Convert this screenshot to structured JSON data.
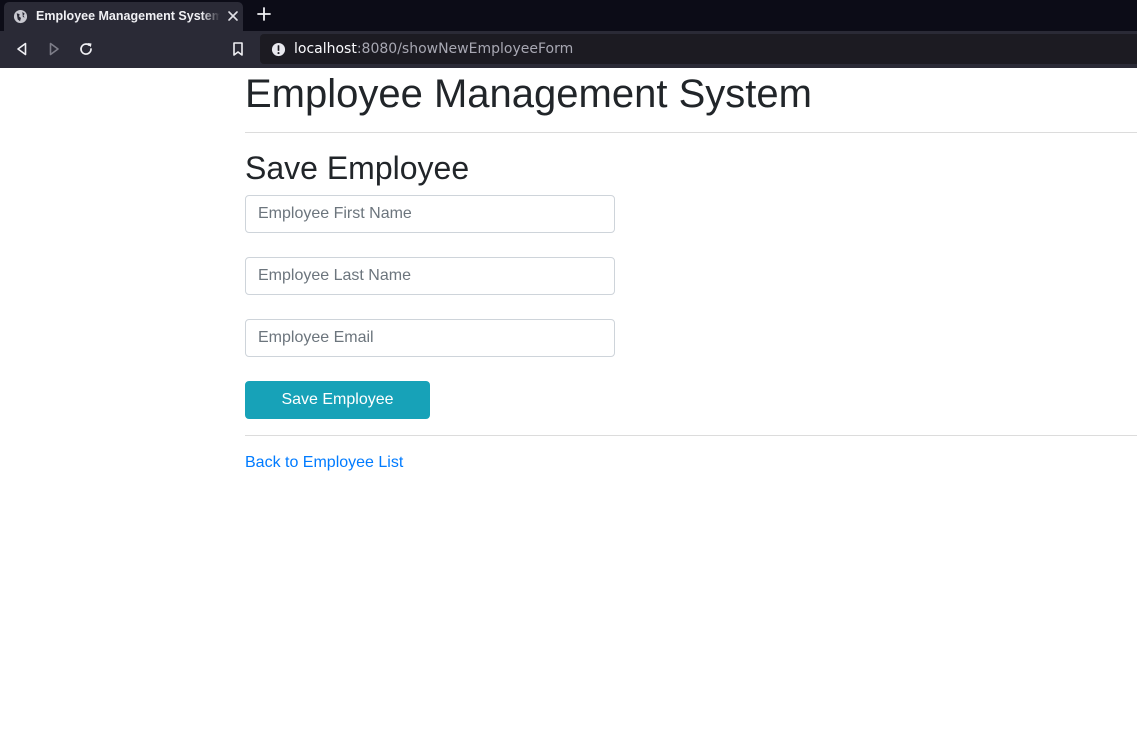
{
  "browser": {
    "tab": {
      "title": "Employee Management System",
      "favicon": "globe-icon"
    },
    "url": {
      "host": "localhost",
      "path": ":8080/showNewEmployeeForm"
    },
    "icons": [
      "back-icon",
      "forward-icon",
      "reload-icon",
      "bookmark-icon",
      "site-info-icon",
      "close-icon",
      "plus-icon"
    ]
  },
  "page": {
    "title": "Employee Management System",
    "section_title": "Save Employee",
    "form": {
      "first_name": {
        "value": "",
        "placeholder": "Employee First Name"
      },
      "last_name": {
        "value": "",
        "placeholder": "Employee Last Name"
      },
      "email": {
        "value": "",
        "placeholder": "Employee Email"
      },
      "submit_label": "Save Employee"
    },
    "back_link": "Back to Employee List"
  },
  "colors": {
    "accent": "#17a2b8",
    "link": "#007bff",
    "text": "#212529",
    "chrome_dark": "#0c0c17",
    "chrome_toolbar": "#2a2a36"
  }
}
